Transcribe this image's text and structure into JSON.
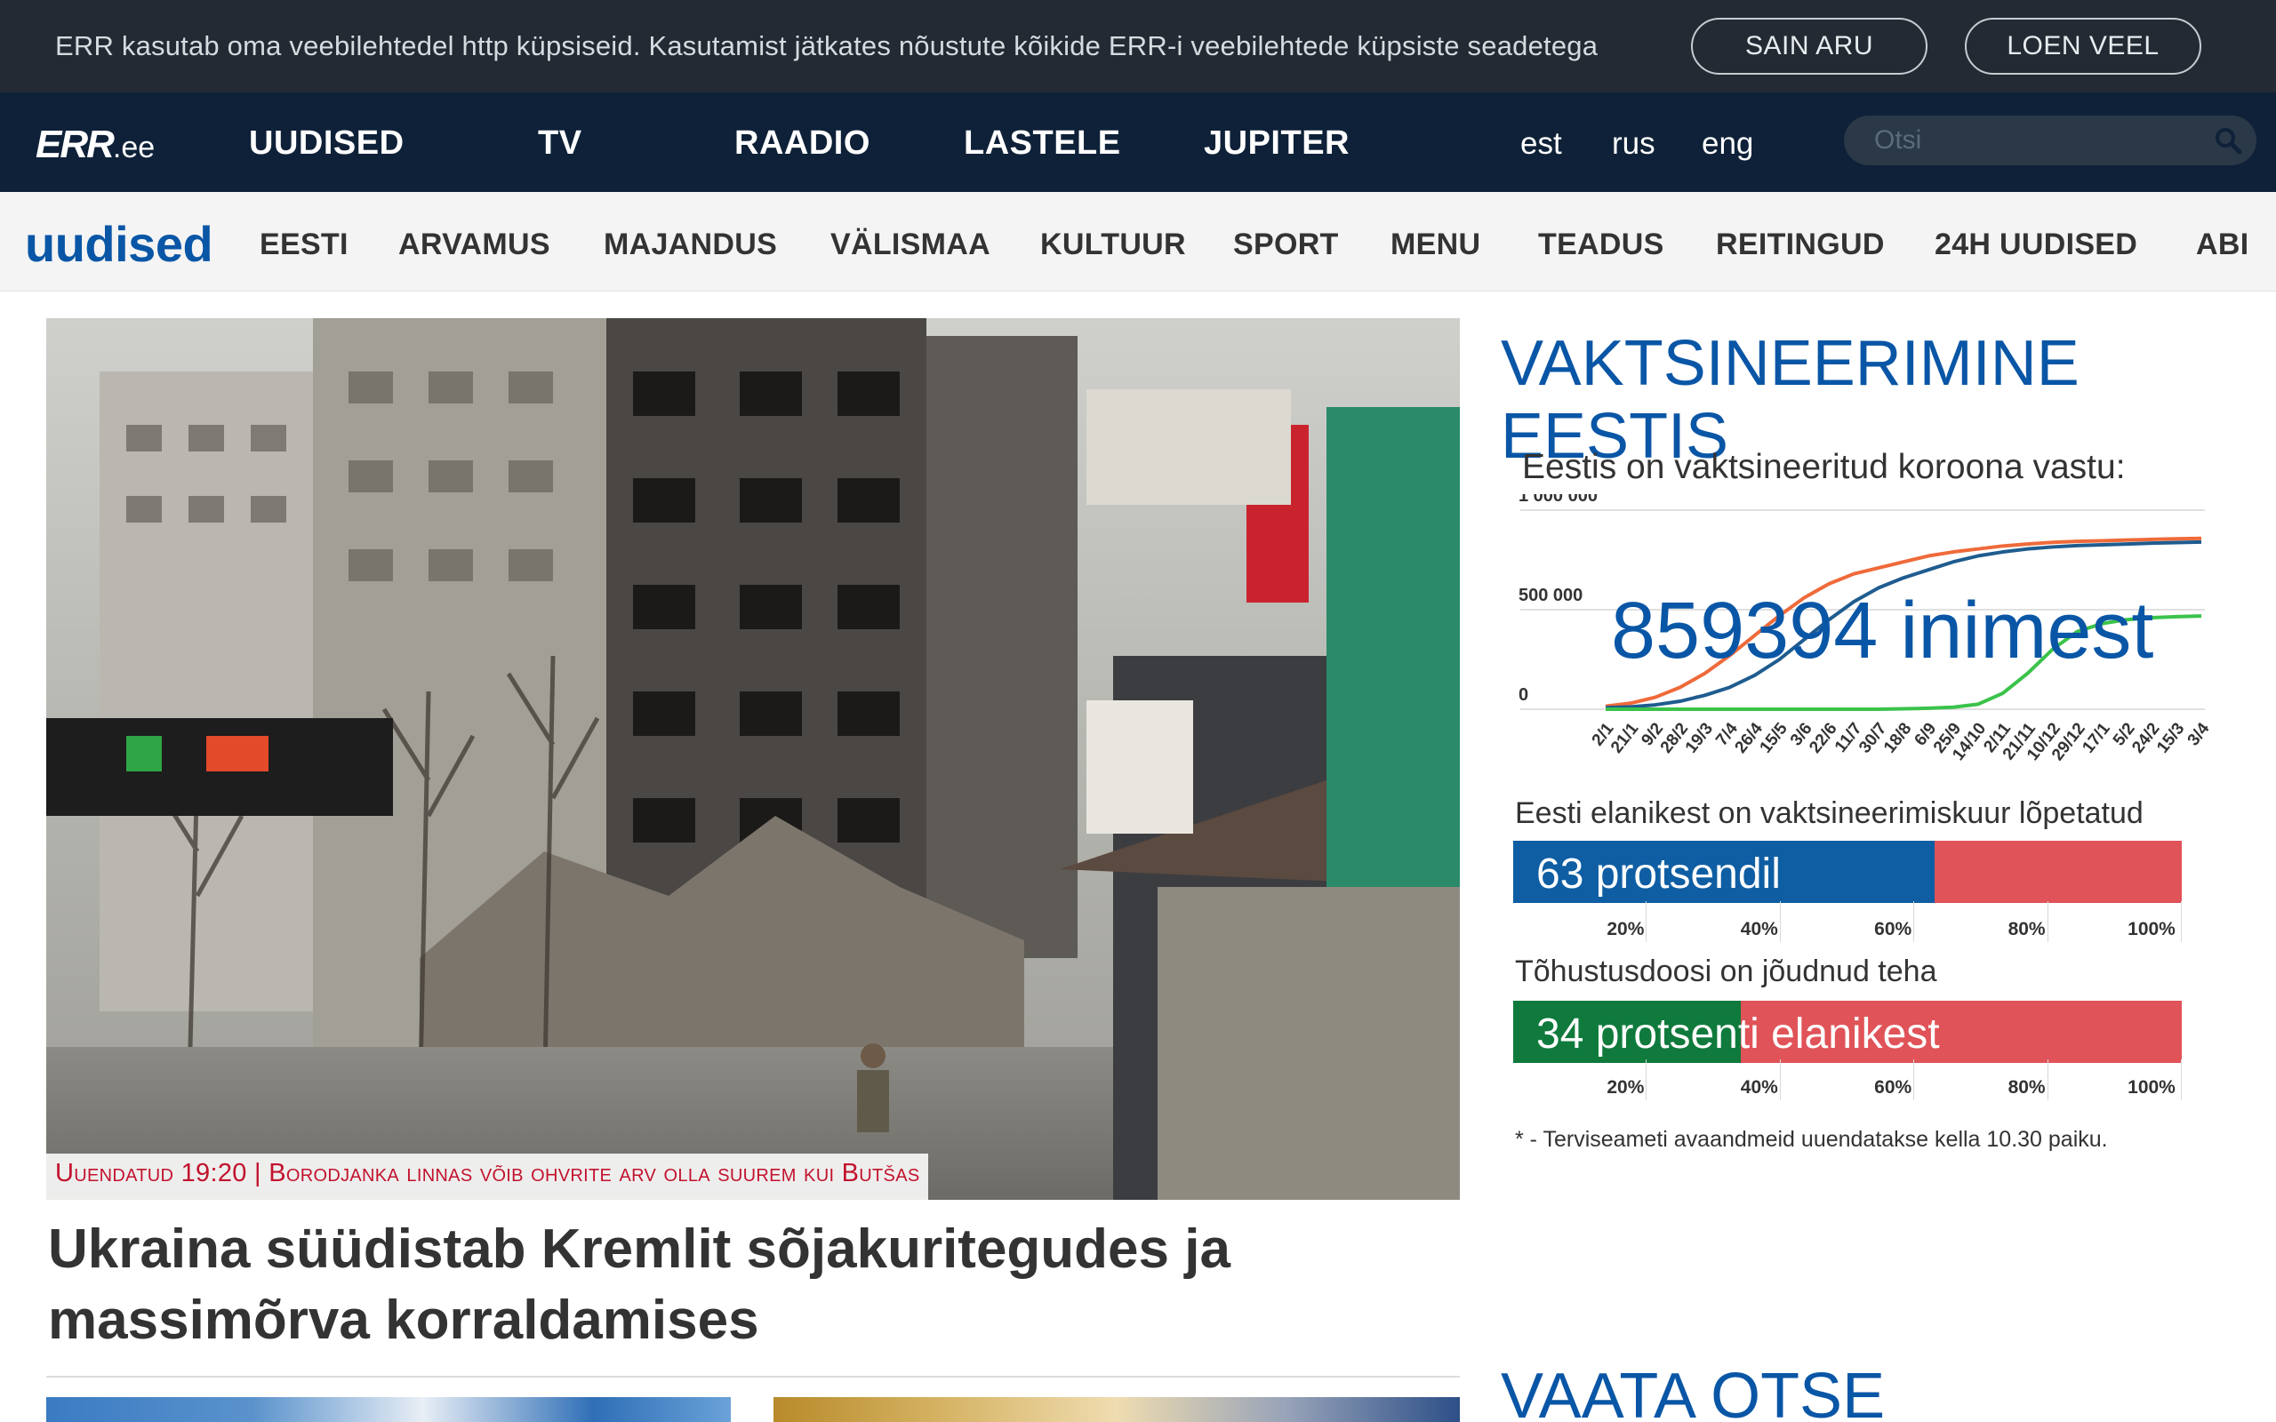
{
  "cookie": {
    "text": "ERR kasutab oma veebilehtedel http küpsiseid. Kasutamist jätkates nõustute kõikide ERR-i veebilehtede küpsiste seadetega",
    "accept_label": "SAIN ARU",
    "more_label": "LOEN VEEL"
  },
  "header": {
    "logo_main": "ERR",
    "logo_suffix": ".ee",
    "nav": [
      "UUDISED",
      "TV",
      "RAADIO",
      "LASTELE",
      "JUPITER"
    ],
    "languages": [
      "est",
      "rus",
      "eng"
    ],
    "search_placeholder": "Otsi"
  },
  "subnav": {
    "section": "uudised",
    "items": [
      "EESTI",
      "ARVAMUS",
      "MAJANDUS",
      "VÄLISMAA",
      "KULTUUR",
      "SPORT",
      "MENU",
      "TEADUS",
      "REITINGUD",
      "24H UUDISED",
      "ABI"
    ]
  },
  "hero": {
    "kicker": "Uuendatud 19:20 | Borodjanka linnas võib ohvrite arv olla suurem kui Butšas",
    "headline": "Ukraina süüdistab Kremlit sõjakuritegudes ja massimõrva korraldamises",
    "image_alt": "Destroyed apartment buildings on a city street"
  },
  "sidebar": {
    "title": "VAKTSINEERIMINE EESTIS",
    "chart_title": "Eestis on vaktsineeritud koroona vastu:",
    "count_text": "859394 inimest",
    "coverage_caption": "Eesti elanikest on vaktsineerimiskuur lõpetatud",
    "coverage_percent": 63,
    "coverage_label": "63 protsendil",
    "booster_caption": "Tõhustusdoosi on jõudnud teha",
    "booster_percent": 34,
    "booster_label": "34 protsenti elanikest",
    "tick_labels": [
      "20%",
      "40%",
      "60%",
      "80%",
      "100%"
    ],
    "footnote": "* - Terviseameti avaandmeid uuendatakse kella 10.30 paiku.",
    "live_title": "VAATA OTSE"
  },
  "colors": {
    "accent": "#0a56a6",
    "kicker": "#c2132d",
    "nav_bg": "#0e2138",
    "cookie_bg": "#232a33",
    "coverage": "#0f5ea3",
    "booster": "#0f7a3c",
    "remaining": "#e05358"
  },
  "chart_data": {
    "type": "line",
    "title": "",
    "ylim": [
      0,
      1000000
    ],
    "y_ticks": [
      "0",
      "500 000",
      "1 000 000"
    ],
    "categories": [
      "2/1",
      "21/1",
      "9/2",
      "28/2",
      "19/3",
      "7/4",
      "26/4",
      "15/5",
      "3/6",
      "22/6",
      "11/7",
      "30/7",
      "18/8",
      "6/9",
      "25/9",
      "14/10",
      "2/11",
      "21/11",
      "10/12",
      "29/12",
      "17/1",
      "5/2",
      "24/2",
      "15/3",
      "3/4"
    ],
    "series": [
      {
        "color": "#ef6a3a",
        "values": [
          15000,
          30000,
          60000,
          110000,
          180000,
          270000,
          370000,
          470000,
          560000,
          630000,
          680000,
          710000,
          740000,
          770000,
          790000,
          805000,
          820000,
          830000,
          838000,
          843000,
          846000,
          850000,
          853000,
          856000,
          858000
        ]
      },
      {
        "color": "#1f5c8f",
        "values": [
          8000,
          12000,
          22000,
          40000,
          70000,
          110000,
          170000,
          250000,
          350000,
          450000,
          540000,
          610000,
          660000,
          700000,
          740000,
          770000,
          790000,
          805000,
          815000,
          822000,
          826000,
          830000,
          834000,
          837000,
          840000
        ]
      },
      {
        "color": "#3ac34a",
        "values": [
          0,
          0,
          0,
          0,
          0,
          0,
          0,
          0,
          0,
          0,
          0,
          0,
          2000,
          5000,
          10000,
          25000,
          80000,
          180000,
          300000,
          390000,
          430000,
          450000,
          460000,
          465000,
          468000
        ]
      }
    ]
  }
}
